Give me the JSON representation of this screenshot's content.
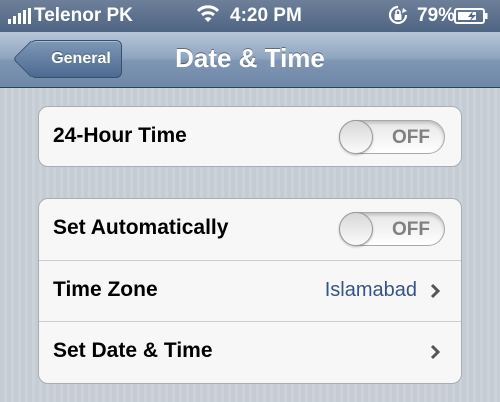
{
  "status_bar": {
    "carrier": "Telenor PK",
    "time": "4:20 PM",
    "battery_percent": "79%",
    "icons": [
      "signal-icon",
      "wifi-icon",
      "rotation-lock-icon",
      "battery-icon"
    ]
  },
  "nav": {
    "back_label": "General",
    "title": "Date & Time"
  },
  "groups": [
    {
      "rows": [
        {
          "label": "24-Hour Time",
          "control": "toggle",
          "state": "OFF"
        }
      ]
    },
    {
      "rows": [
        {
          "label": "Set Automatically",
          "control": "toggle",
          "state": "OFF"
        },
        {
          "label": "Time Zone",
          "value": "Islamabad",
          "control": "disclosure"
        },
        {
          "label": "Set Date & Time",
          "control": "disclosure"
        }
      ]
    }
  ],
  "colors": {
    "nav_gradient_top": "#b7c6d8",
    "nav_gradient_bottom": "#6f88a8",
    "value_text": "#385487",
    "background": "#c5ccd4"
  }
}
